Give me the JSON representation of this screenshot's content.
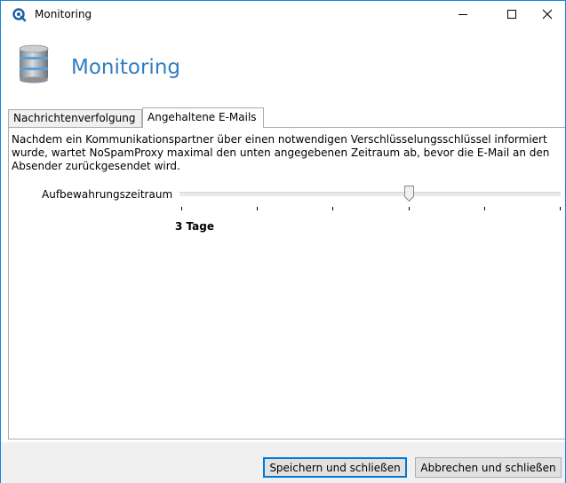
{
  "window": {
    "title": "Monitoring",
    "accent_color": "#1883d7"
  },
  "header": {
    "title": "Monitoring",
    "title_color": "#2f7ec1",
    "icon": "database-stack-icon"
  },
  "tabs": [
    {
      "label": "Nachrichtenverfolgung",
      "active": false
    },
    {
      "label": "Angehaltene E-Mails",
      "active": true
    }
  ],
  "panel": {
    "description_lines": [
      "Nachdem ein Kommunikationspartner über einen notwendigen Verschlüsselungsschlüssel informiert",
      "wurde, wartet NoSpamProxy maximal den unten angegebenen Zeitraum ab, bevor die E-Mail an den",
      "Absender zurückgesendet wird."
    ],
    "slider": {
      "label": "Aufbewahrungszeitraum",
      "value_text": "3 Tage",
      "value": 3,
      "tick_count": 6,
      "thumb_fraction": 0.6
    }
  },
  "buttons": {
    "save": "Speichern und schließen",
    "cancel": "Abbrechen und schließen"
  }
}
